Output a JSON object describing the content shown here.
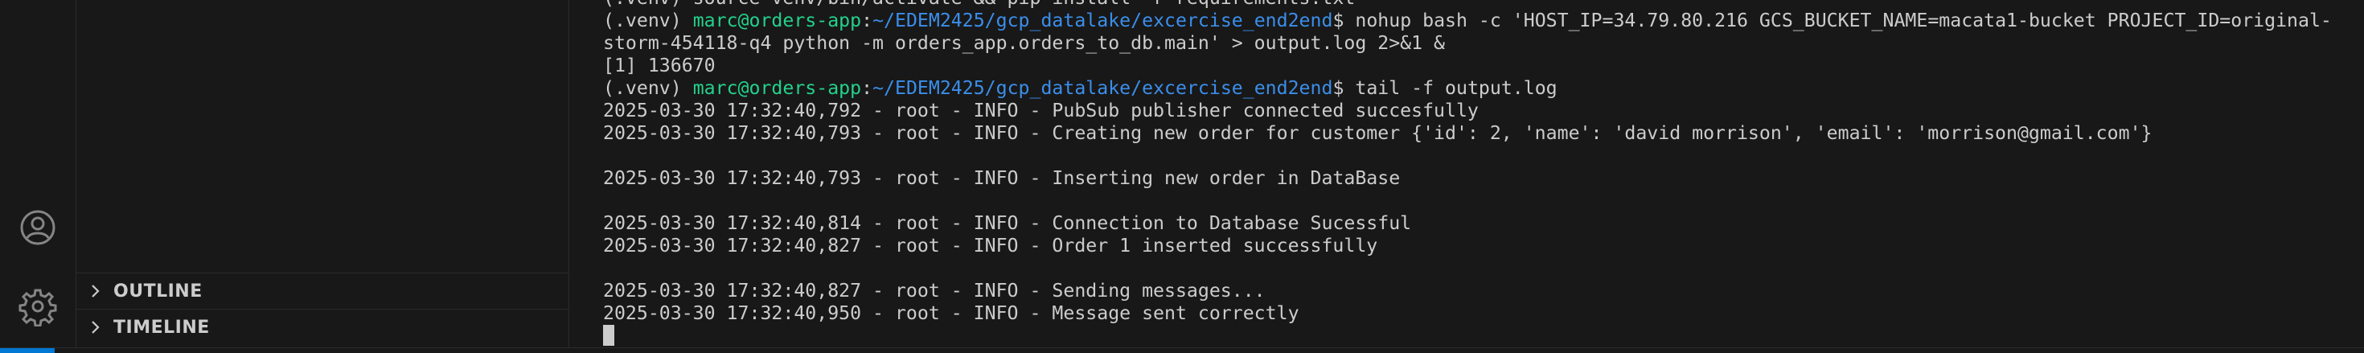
{
  "sidebar": {
    "sections": [
      {
        "label": "OUTLINE",
        "icon": "chevron-right-icon"
      },
      {
        "label": "TIMELINE",
        "icon": "chevron-right-icon"
      }
    ]
  },
  "activity_bar": {
    "icons": [
      "accounts-icon",
      "manage-gear-icon"
    ]
  },
  "terminal": {
    "lines": [
      {
        "segments": [
          {
            "t": "(.venv) source venv/bin/activate && pip install -r requirements.txt",
            "c": "w"
          }
        ]
      },
      {
        "segments": [
          {
            "t": "(.venv) ",
            "c": "w"
          },
          {
            "t": "marc@orders-app",
            "c": "u"
          },
          {
            "t": ":",
            "c": "w"
          },
          {
            "t": "~/EDEM2425/gcp_datalake/excercise_end2end",
            "c": "p"
          },
          {
            "t": "$ nohup bash -c 'HOST_IP=34.79.80.216 GCS_BUCKET_NAME=macata1-bucket PROJECT_ID=original-",
            "c": "w"
          }
        ]
      },
      {
        "segments": [
          {
            "t": "storm-454118-q4 python -m orders_app.orders_to_db.main' > output.log 2>&1 &",
            "c": "w"
          }
        ]
      },
      {
        "segments": [
          {
            "t": "[1] 136670",
            "c": "w"
          }
        ]
      },
      {
        "segments": [
          {
            "t": "(.venv) ",
            "c": "w"
          },
          {
            "t": "marc@orders-app",
            "c": "u"
          },
          {
            "t": ":",
            "c": "w"
          },
          {
            "t": "~/EDEM2425/gcp_datalake/excercise_end2end",
            "c": "p"
          },
          {
            "t": "$ tail -f output.log",
            "c": "w"
          }
        ]
      },
      {
        "segments": [
          {
            "t": "2025-03-30 17:32:40,792 - root - INFO - PubSub publisher connected succesfully",
            "c": "w"
          }
        ]
      },
      {
        "segments": [
          {
            "t": "2025-03-30 17:32:40,793 - root - INFO - Creating new order for customer {'id': 2, 'name': 'david morrison', 'email': 'morrison@gmail.com'}",
            "c": "w"
          }
        ]
      },
      {
        "segments": [
          {
            "t": "",
            "c": "w"
          }
        ]
      },
      {
        "segments": [
          {
            "t": "2025-03-30 17:32:40,793 - root - INFO - Inserting new order in DataBase",
            "c": "w"
          }
        ]
      },
      {
        "segments": [
          {
            "t": "",
            "c": "w"
          }
        ]
      },
      {
        "segments": [
          {
            "t": "2025-03-30 17:32:40,814 - root - INFO - Connection to Database Sucessful",
            "c": "w"
          }
        ]
      },
      {
        "segments": [
          {
            "t": "2025-03-30 17:32:40,827 - root - INFO - Order 1 inserted successfully",
            "c": "w"
          }
        ]
      },
      {
        "segments": [
          {
            "t": "",
            "c": "w"
          }
        ]
      },
      {
        "segments": [
          {
            "t": "2025-03-30 17:32:40,827 - root - INFO - Sending messages...",
            "c": "w"
          }
        ]
      },
      {
        "segments": [
          {
            "t": "2025-03-30 17:32:40,950 - root - INFO - Message sent correctly",
            "c": "w"
          }
        ]
      }
    ]
  },
  "colors": {
    "background": "#181818",
    "text": "#cccccc",
    "prompt_user": "#23d18b",
    "prompt_path": "#3b8eea",
    "status_remote": "#0078d4"
  }
}
